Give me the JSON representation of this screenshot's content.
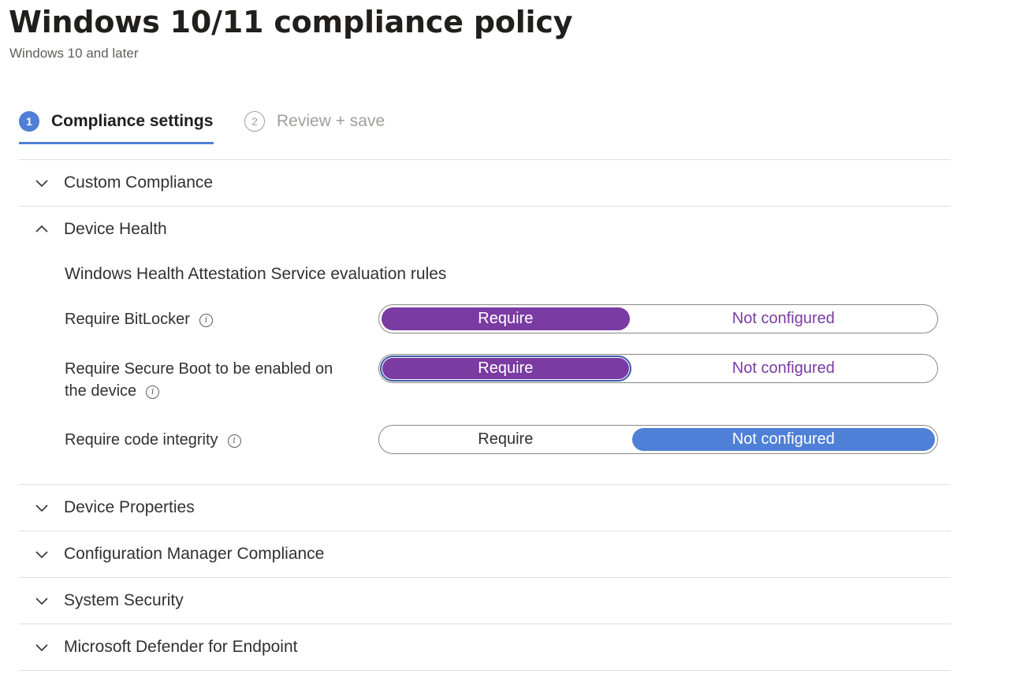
{
  "header": {
    "title": "Windows 10/11 compliance policy",
    "more": "···",
    "subtitle": "Windows 10 and later"
  },
  "steps": [
    {
      "number": "1",
      "label": "Compliance settings",
      "active": true
    },
    {
      "number": "2",
      "label": "Review + save",
      "active": false
    }
  ],
  "sections": {
    "custom_compliance": "Custom Compliance",
    "device_health": "Device Health",
    "device_properties": "Device Properties",
    "config_manager": "Configuration Manager Compliance",
    "system_security": "System Security",
    "defender": "Microsoft Defender for Endpoint"
  },
  "device_health": {
    "group_title": "Windows Health Attestation Service evaluation rules",
    "settings": [
      {
        "label": "Require BitLocker",
        "value": "Require"
      },
      {
        "label_line1": "Require Secure Boot to be enabled on",
        "label_line2": "the device",
        "value": "Require"
      },
      {
        "label": "Require code integrity",
        "value": "Not configured"
      }
    ],
    "option_require": "Require",
    "option_not_configured": "Not configured"
  },
  "colors": {
    "accent_blue": "#4f7fd6",
    "selected_purple": "#7a3ba3"
  },
  "icons": {
    "info": "i",
    "more": "more-icon",
    "chevron_down": "chevron-down-icon",
    "chevron_up": "chevron-up-icon"
  }
}
